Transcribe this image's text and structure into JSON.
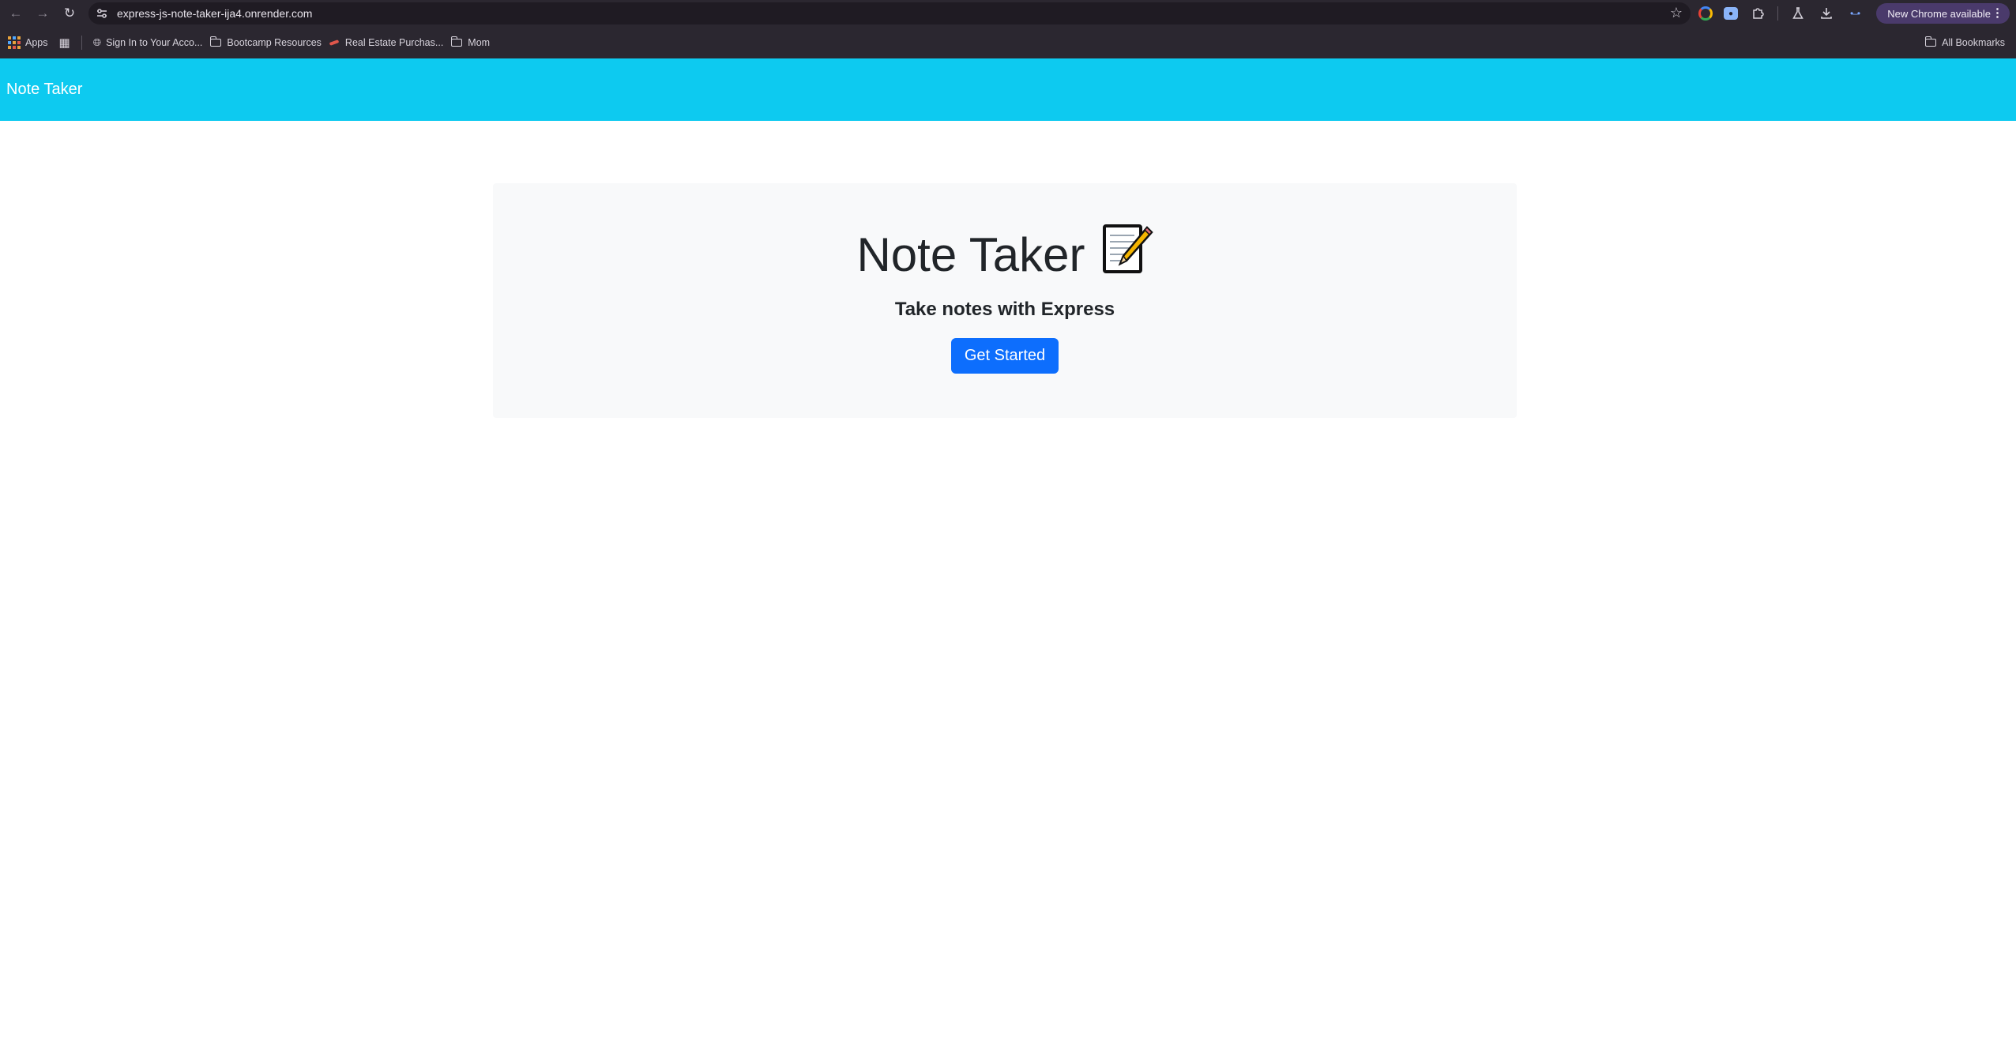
{
  "browser": {
    "url": "express-js-note-taker-ija4.onrender.com",
    "update_label": "New Chrome available",
    "bookmarks": {
      "apps": "Apps",
      "items": [
        "Sign In to Your Acco...",
        "Bootcamp Resources",
        "Real Estate Purchas...",
        "Mom"
      ],
      "all": "All Bookmarks"
    }
  },
  "navbar": {
    "brand": "Note Taker",
    "color": "#0dcaf0"
  },
  "hero": {
    "title": "Note Taker",
    "emoji": "📝",
    "subtitle": "Take notes with Express",
    "button": "Get Started",
    "button_color": "#0d6efd"
  }
}
